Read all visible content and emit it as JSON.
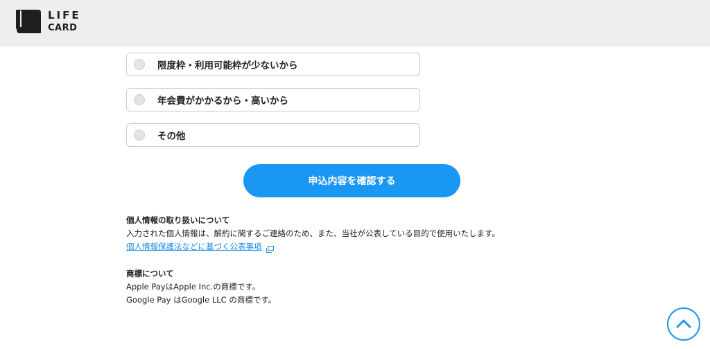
{
  "header": {
    "logo_line1": "LIFE",
    "logo_line2": "CARD"
  },
  "options": [
    {
      "label": "限度枠・利用可能枠が少ないから",
      "selected": false
    },
    {
      "label": "年会費がかかるから・高いから",
      "selected": false
    },
    {
      "label": "その他",
      "selected": false
    }
  ],
  "confirm_button": {
    "label": "申込内容を確認する"
  },
  "privacy": {
    "title": "個人情報の取り扱いについて",
    "body": "入力された個人情報は、解約に関するご連絡のため、また、当社が公表している目的で使用いたします。",
    "link_text": "個人情報保護法などに基づく公表事項"
  },
  "trademark": {
    "title": "商標について",
    "line1": "Apple PayはApple Inc.の商標です。",
    "line2": "Google Pay はGoogle LLC の商標です。"
  },
  "colors": {
    "accent": "#1a96f3",
    "link": "#1a8ae8",
    "header_bg": "#eeeeee"
  },
  "icons": {
    "logo": "life-card-logo-icon",
    "external_link": "external-link-icon",
    "back_to_top": "chevron-up-icon"
  }
}
